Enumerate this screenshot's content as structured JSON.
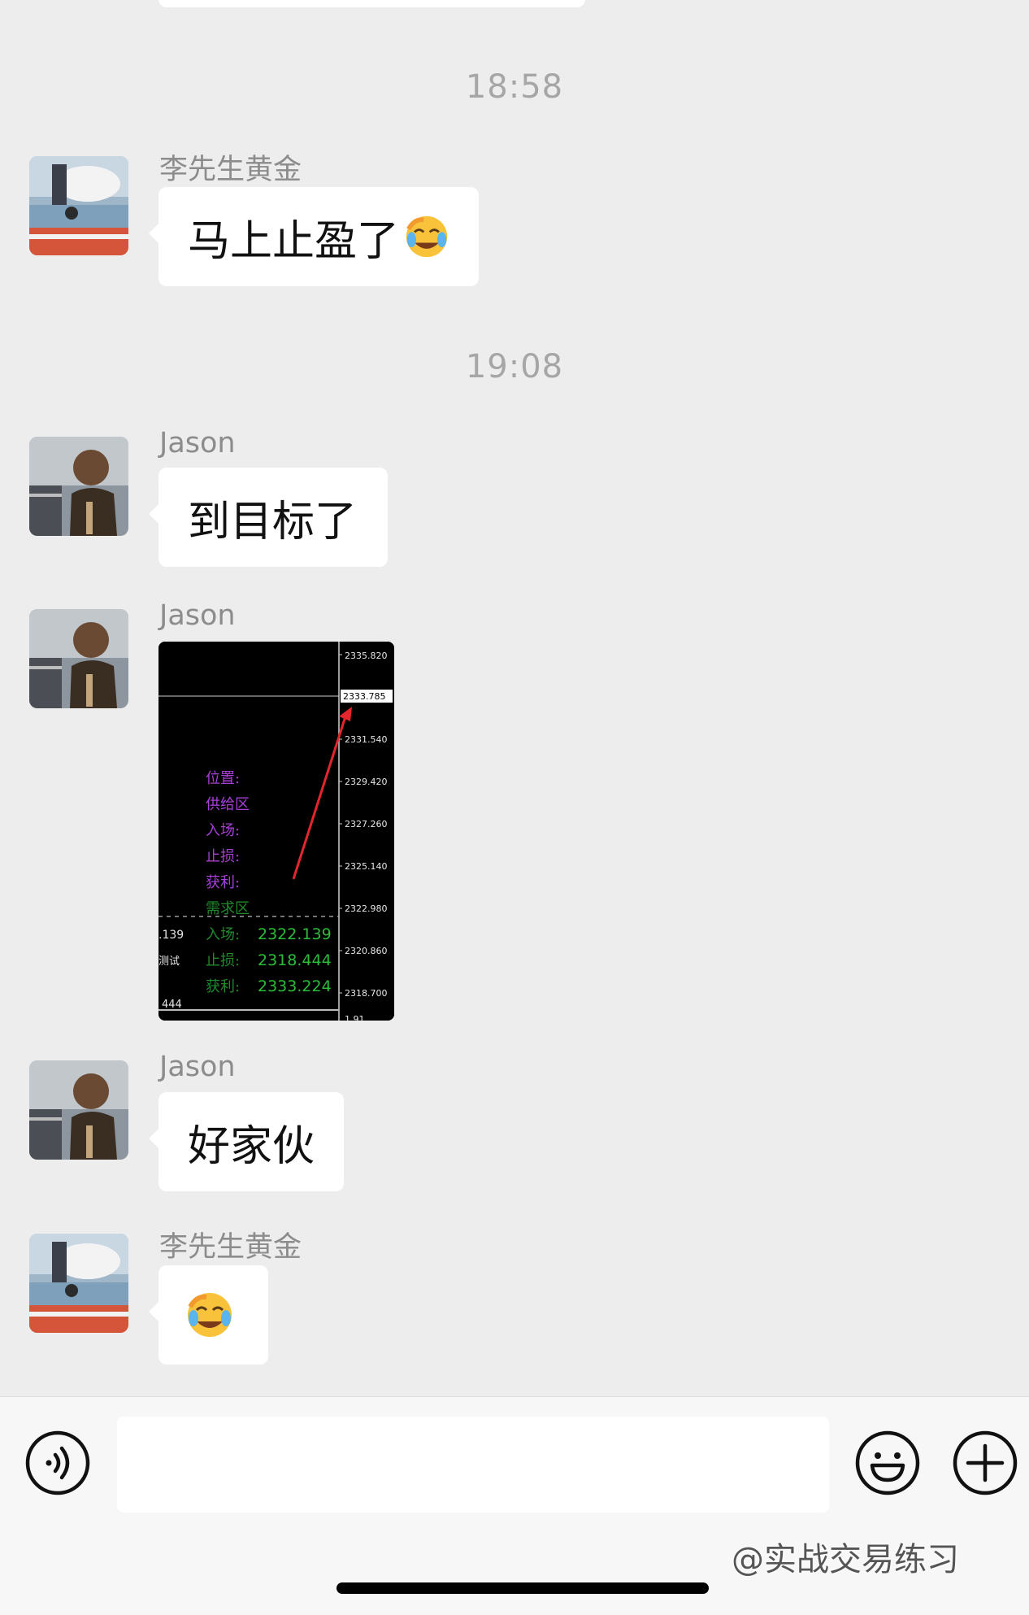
{
  "timestamps": [
    "18:58",
    "19:08"
  ],
  "messages": [
    {
      "sender": "李先生黄金",
      "text": "马上止盈了",
      "emoji": "crying-laughing-emoji"
    },
    {
      "sender": "Jason",
      "text": "到目标了"
    },
    {
      "sender": "Jason",
      "type": "image"
    },
    {
      "sender": "Jason",
      "text": "好家伙"
    },
    {
      "sender": "李先生黄金",
      "text": "",
      "emoji": "crying-laughing-emoji"
    }
  ],
  "chart_image": {
    "price_labels": [
      "2335.820",
      "2333.785",
      "2331.540",
      "2329.420",
      "2327.260",
      "2325.140",
      "2322.980",
      "2320.860",
      "2318.700",
      "1.91"
    ],
    "current_price": "2333.785",
    "purple_lines": [
      "位置:",
      "供给区",
      "入场:",
      "止损:",
      "获利:"
    ],
    "green_header": "需求区",
    "green_lines": [
      {
        "label": "入场:",
        "value": "2322.139"
      },
      {
        "label": "止损:",
        "value": "2318.444"
      },
      {
        "label": "获利:",
        "value": "2333.224"
      }
    ],
    "left_fragments": [
      ".139",
      "测试",
      "444"
    ]
  },
  "input_bar": {
    "placeholder": "",
    "icons": [
      "voice-icon",
      "emoji-icon",
      "plus-icon"
    ]
  },
  "watermark": "@实战交易练习",
  "colors": {
    "background": "#ededed",
    "bubble": "#ffffff",
    "timestamp": "#a6a6a6",
    "sender": "#8c8c8c",
    "chart_purple": "#a63fd6",
    "chart_green": "#2bbd3a",
    "arrow_red": "#e3262e"
  }
}
